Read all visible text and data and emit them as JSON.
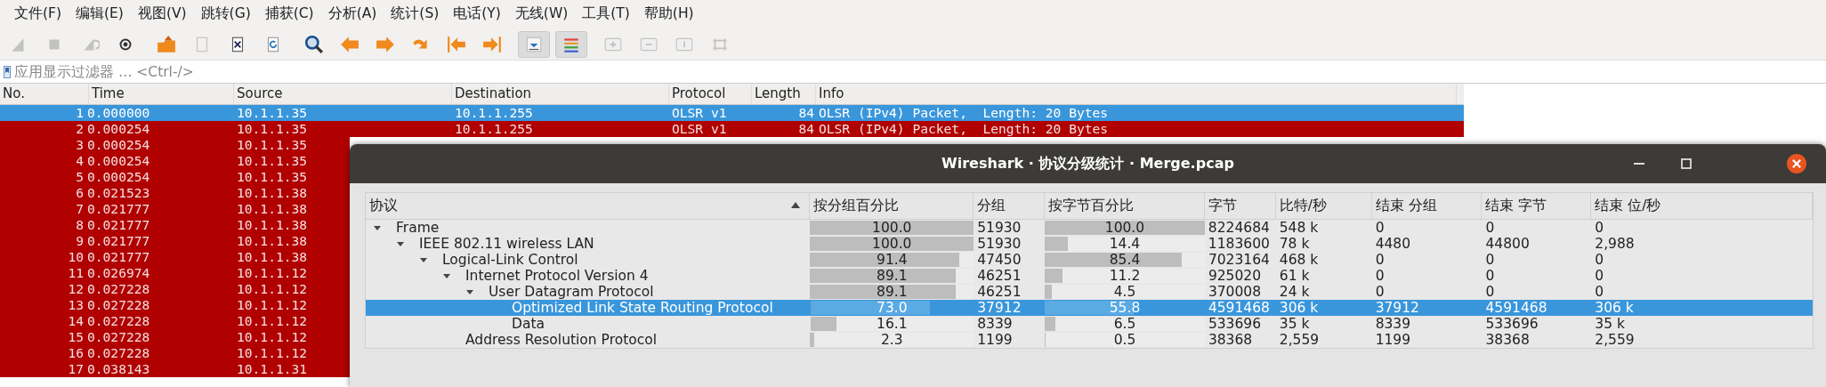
{
  "menu": [
    "文件(F)",
    "编辑(E)",
    "视图(V)",
    "跳转(G)",
    "捕获(C)",
    "分析(A)",
    "统计(S)",
    "电话(Y)",
    "无线(W)",
    "工具(T)",
    "帮助(H)"
  ],
  "toolbar": [
    {
      "kind": "fin",
      "disabled": true,
      "pressed": false
    },
    {
      "kind": "stop",
      "disabled": true,
      "pressed": false
    },
    {
      "kind": "restart",
      "disabled": true,
      "pressed": false
    },
    {
      "kind": "options",
      "disabled": false,
      "pressed": false
    },
    {
      "kind": "open",
      "disabled": false,
      "pressed": false
    },
    {
      "kind": "save",
      "disabled": true,
      "pressed": false
    },
    {
      "kind": "close",
      "disabled": false,
      "pressed": false
    },
    {
      "kind": "reload",
      "disabled": false,
      "pressed": false
    },
    {
      "kind": "find",
      "disabled": false,
      "pressed": false
    },
    {
      "kind": "back",
      "disabled": false,
      "pressed": false
    },
    {
      "kind": "forward",
      "disabled": false,
      "pressed": false
    },
    {
      "kind": "goto",
      "disabled": false,
      "pressed": false
    },
    {
      "kind": "first",
      "disabled": false,
      "pressed": false
    },
    {
      "kind": "last",
      "disabled": false,
      "pressed": false
    },
    {
      "kind": "autoscroll",
      "disabled": false,
      "pressed": true
    },
    {
      "kind": "colorize",
      "disabled": false,
      "pressed": true
    },
    {
      "kind": "zoomin",
      "disabled": true,
      "pressed": false
    },
    {
      "kind": "zoomout",
      "disabled": true,
      "pressed": false
    },
    {
      "kind": "normal",
      "disabled": true,
      "pressed": false
    },
    {
      "kind": "resize",
      "disabled": true,
      "pressed": false
    }
  ],
  "filter": {
    "placeholder": "应用显示过滤器 … <Ctrl-/>"
  },
  "packet_list": {
    "columns": [
      "No.",
      "Time",
      "Source",
      "Destination",
      "Protocol",
      "Length",
      "Info"
    ],
    "rows": [
      {
        "selected": true,
        "cells": [
          "1",
          "0.000000",
          "10.1.1.35",
          "10.1.1.255",
          "OLSR v1",
          "84",
          "OLSR (IPv4) Packet,  Length: 20 Bytes"
        ]
      },
      {
        "selected": false,
        "cells": [
          "2",
          "0.000254",
          "10.1.1.35",
          "10.1.1.255",
          "OLSR v1",
          "84",
          "OLSR (IPv4) Packet,  Length: 20 Bytes"
        ]
      },
      {
        "selected": false,
        "cells": [
          "3",
          "0.000254",
          "10.1.1.35"
        ]
      },
      {
        "selected": false,
        "cells": [
          "4",
          "0.000254",
          "10.1.1.35"
        ]
      },
      {
        "selected": false,
        "cells": [
          "5",
          "0.000254",
          "10.1.1.35"
        ]
      },
      {
        "selected": false,
        "cells": [
          "6",
          "0.021523",
          "10.1.1.38"
        ]
      },
      {
        "selected": false,
        "cells": [
          "7",
          "0.021777",
          "10.1.1.38"
        ]
      },
      {
        "selected": false,
        "cells": [
          "8",
          "0.021777",
          "10.1.1.38"
        ]
      },
      {
        "selected": false,
        "cells": [
          "9",
          "0.021777",
          "10.1.1.38"
        ]
      },
      {
        "selected": false,
        "cells": [
          "10",
          "0.021777",
          "10.1.1.38"
        ]
      },
      {
        "selected": false,
        "cells": [
          "11",
          "0.026974",
          "10.1.1.12"
        ]
      },
      {
        "selected": false,
        "cells": [
          "12",
          "0.027228",
          "10.1.1.12"
        ]
      },
      {
        "selected": false,
        "cells": [
          "13",
          "0.027228",
          "10.1.1.12"
        ]
      },
      {
        "selected": false,
        "cells": [
          "14",
          "0.027228",
          "10.1.1.12"
        ]
      },
      {
        "selected": false,
        "cells": [
          "15",
          "0.027228",
          "10.1.1.12"
        ]
      },
      {
        "selected": false,
        "cells": [
          "16",
          "0.027228",
          "10.1.1.12"
        ]
      },
      {
        "selected": false,
        "cells": [
          "17",
          "0.038143",
          "10.1.1.31"
        ]
      }
    ]
  },
  "dialog": {
    "title": "Wireshark · 协议分级统计 · Merge.pcap",
    "columns": [
      "协议",
      "按分组百分比",
      "分组",
      "按字节百分比",
      "字节",
      "比特/秒",
      "结束 分组",
      "结束 字节",
      "结束 位/秒"
    ],
    "tree": [
      {
        "name": "Frame",
        "expanded": true,
        "selected": false,
        "pkt_share": {
          "text": "100.0",
          "level": 1.0
        },
        "packets": "51930",
        "byte_share": {
          "text": "100.0",
          "level": 1.0
        },
        "bytes": "8224684",
        "bps": "548 k",
        "end_packets": "0",
        "end_bytes": "0",
        "end_bps": "0",
        "children": [
          {
            "name": "IEEE 802.11 wireless LAN",
            "expanded": true,
            "selected": false,
            "pkt_share": {
              "text": "100.0",
              "level": 1.0
            },
            "packets": "51930",
            "byte_share": {
              "text": "14.4",
              "level": 0.144
            },
            "bytes": "1183600",
            "bps": "78 k",
            "end_packets": "4480",
            "end_bytes": "44800",
            "end_bps": "2,988",
            "children": [
              {
                "name": "Logical-Link Control",
                "expanded": true,
                "selected": false,
                "pkt_share": {
                  "text": "91.4",
                  "level": 0.914
                },
                "packets": "47450",
                "byte_share": {
                  "text": "85.4",
                  "level": 0.854
                },
                "bytes": "7023164",
                "bps": "468 k",
                "end_packets": "0",
                "end_bytes": "0",
                "end_bps": "0",
                "children": [
                  {
                    "name": "Internet Protocol Version 4",
                    "expanded": true,
                    "selected": false,
                    "pkt_share": {
                      "text": "89.1",
                      "level": 0.891
                    },
                    "packets": "46251",
                    "byte_share": {
                      "text": "11.2",
                      "level": 0.112
                    },
                    "bytes": "925020",
                    "bps": "61 k",
                    "end_packets": "0",
                    "end_bytes": "0",
                    "end_bps": "0",
                    "children": [
                      {
                        "name": "User Datagram Protocol",
                        "expanded": true,
                        "selected": false,
                        "pkt_share": {
                          "text": "89.1",
                          "level": 0.891
                        },
                        "packets": "46251",
                        "byte_share": {
                          "text": "4.5",
                          "level": 0.045
                        },
                        "bytes": "370008",
                        "bps": "24 k",
                        "end_packets": "0",
                        "end_bytes": "0",
                        "end_bps": "0",
                        "children": [
                          {
                            "name": "Optimized Link State Routing Protocol",
                            "selected": true,
                            "pkt_share": {
                              "text": "73.0",
                              "level": 0.73
                            },
                            "packets": "37912",
                            "byte_share": {
                              "text": "55.8",
                              "level": 0.558
                            },
                            "bytes": "4591468",
                            "bps": "306 k",
                            "end_packets": "37912",
                            "end_bytes": "4591468",
                            "end_bps": "306 k"
                          },
                          {
                            "name": "Data",
                            "selected": false,
                            "pkt_share": {
                              "text": "16.1",
                              "level": 0.161
                            },
                            "packets": "8339",
                            "byte_share": {
                              "text": "6.5",
                              "level": 0.065
                            },
                            "bytes": "533696",
                            "bps": "35 k",
                            "end_packets": "8339",
                            "end_bytes": "533696",
                            "end_bps": "35 k"
                          }
                        ]
                      }
                    ]
                  },
                  {
                    "name": "Address Resolution Protocol",
                    "selected": false,
                    "pkt_share": {
                      "text": "2.3",
                      "level": 0.023
                    },
                    "packets": "1199",
                    "byte_share": {
                      "text": "0.5",
                      "level": 0.005
                    },
                    "bytes": "38368",
                    "bps": "2,559",
                    "end_packets": "1199",
                    "end_bytes": "38368",
                    "end_bps": "2,559"
                  }
                ]
              }
            ]
          }
        ]
      }
    ]
  }
}
